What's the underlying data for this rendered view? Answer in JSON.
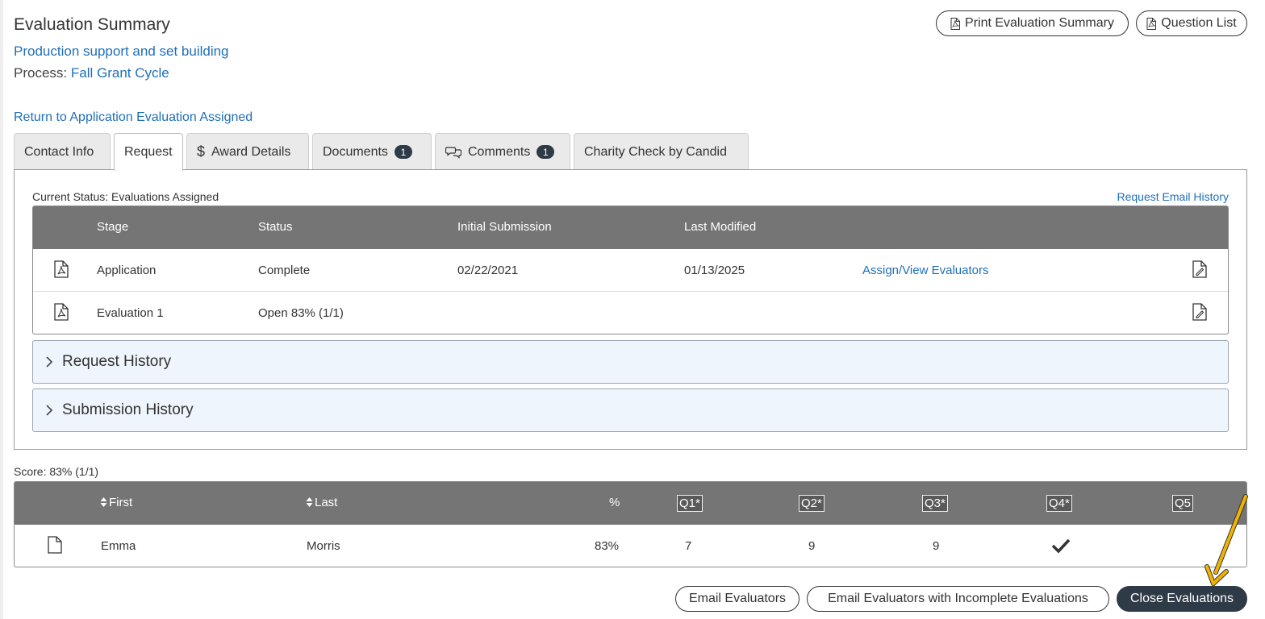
{
  "header": {
    "title": "Evaluation Summary",
    "request_name": "Production support and set building",
    "process_label": "Process:",
    "process_name": "Fall Grant Cycle",
    "return_link": "Return to Application Evaluation Assigned",
    "print_button": "Print Evaluation Summary",
    "question_list_button": "Question List"
  },
  "tabs": [
    {
      "label": "Contact Info"
    },
    {
      "label": "Request",
      "active": true
    },
    {
      "label": "Award Details",
      "icon": "dollar-icon"
    },
    {
      "label": "Documents",
      "badge": "1"
    },
    {
      "label": "Comments",
      "badge": "1",
      "icon": "comments-icon"
    },
    {
      "label": "Charity Check by Candid"
    }
  ],
  "request_panel": {
    "current_status": "Current Status: Evaluations Assigned",
    "email_history_link": "Request Email History",
    "columns": [
      "Stage",
      "Status",
      "Initial Submission",
      "Last Modified"
    ],
    "rows": [
      {
        "stage": "Application",
        "status": "Complete",
        "initial": "02/22/2021",
        "modified": "01/13/2025",
        "action": "Assign/View Evaluators"
      },
      {
        "stage": "Evaluation 1",
        "status": "Open 83% (1/1)",
        "initial": "",
        "modified": "",
        "action": ""
      }
    ],
    "request_history": "Request History",
    "submission_history": "Submission History"
  },
  "evaluations": {
    "score": "Score: 83% (1/1)",
    "columns": {
      "first": "First",
      "last": "Last",
      "pct": "%",
      "q1": "Q1*",
      "q2": "Q2*",
      "q3": "Q3*",
      "q4": "Q4*",
      "q5": "Q5"
    },
    "rows": [
      {
        "first": "Emma",
        "last": "Morris",
        "pct": "83%",
        "q1": "7",
        "q2": "9",
        "q3": "9",
        "q4": "check-icon",
        "q5": ""
      }
    ]
  },
  "footer": {
    "email_evaluators": "Email Evaluators",
    "email_incomplete": "Email Evaluators with Incomplete Evaluations",
    "close_evaluations": "Close Evaluations"
  },
  "colors": {
    "link": "#1f6fb8",
    "header_bg": "#757575",
    "dark_button": "#2e3a46",
    "accordion_bg": "#eef5fc",
    "annotation_arrow": "#f0b400"
  }
}
